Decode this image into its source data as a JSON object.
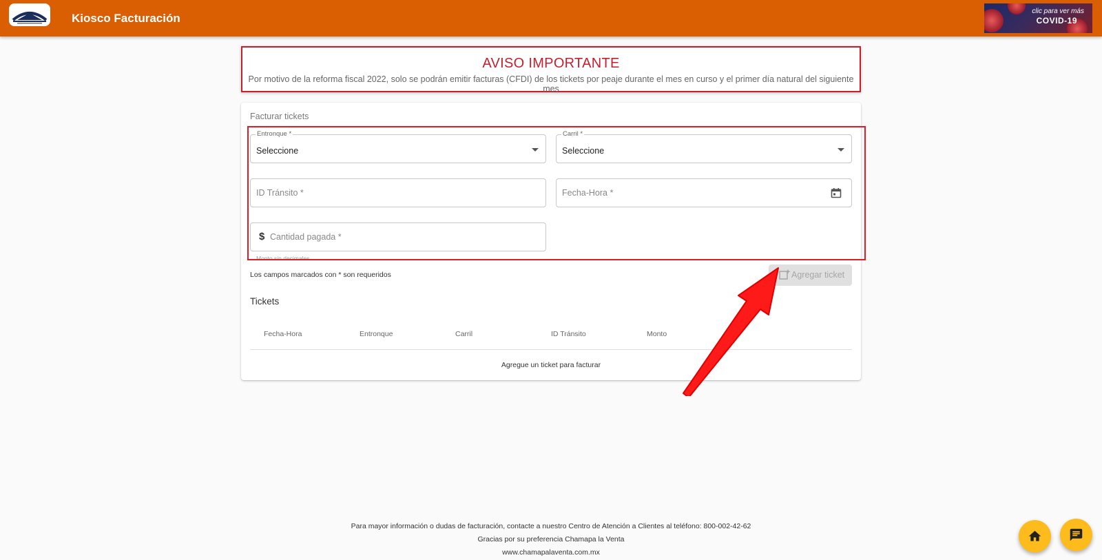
{
  "header": {
    "title": "Kiosco Facturación",
    "banner_small": "clic para ver más",
    "banner_big": "COVID-19"
  },
  "notice": {
    "title": "AVISO IMPORTANTE",
    "text": "Por motivo de la reforma fiscal 2022, solo se podrán emitir facturas (CFDI) de los tickets por peaje durante el mes en curso y el primer día natural del siguiente mes"
  },
  "form": {
    "section_title": "Facturar tickets",
    "entronque": {
      "label": "Entronque *",
      "value": "Seleccione"
    },
    "carril": {
      "label": "Carril *",
      "value": "Seleccione"
    },
    "id_transito": {
      "placeholder": "ID Tránsito *"
    },
    "fecha_hora": {
      "placeholder": "Fecha-Hora *"
    },
    "cantidad": {
      "placeholder": "Cantidad pagada *",
      "hint": "Monto sin decimales"
    },
    "required_note": "Los campos marcados con * son requeridos",
    "add_button": "Agregar ticket"
  },
  "tickets": {
    "title": "Tickets",
    "columns": [
      "Fecha-Hora",
      "Entronque",
      "Carril",
      "ID Tránsito",
      "Monto"
    ],
    "empty_message": "Agregue un ticket para facturar"
  },
  "footer": {
    "contact": "Para mayor información o dudas de facturación, contacte a nuestro Centro de Atención a Clientes al teléfono: 800-002-42-62",
    "thanks": "Gracias por su preferencia Chamapa la Venta",
    "website": "www.chamapalaventa.com.mx"
  },
  "icons": {
    "logo": "chamapa-la-venta-logo",
    "select_arrow": "caret-down-icon",
    "calendar": "calendar-icon",
    "currency": "dollar-icon",
    "add_ticket": "add-box-icon",
    "home": "home-icon",
    "chat": "chat-icon"
  },
  "colors": {
    "header": "#d95f02",
    "notice_red": "#c31f2e",
    "fab": "#fdbb1c",
    "annotation": "#e31b23"
  }
}
